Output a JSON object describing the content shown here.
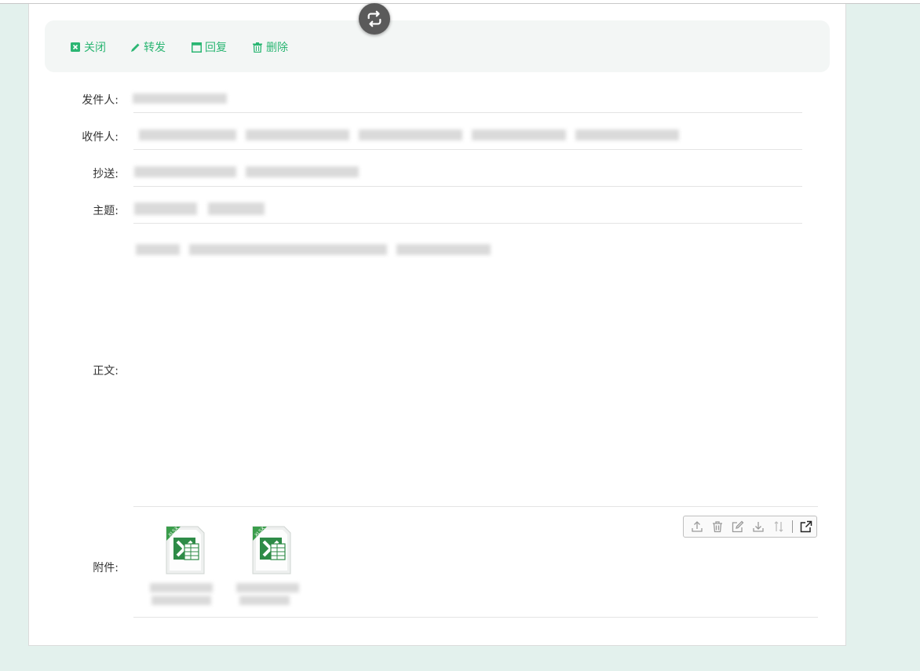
{
  "toolbar": {
    "close_label": "关闭",
    "forward_label": "转发",
    "reply_label": "回复",
    "delete_label": "删除"
  },
  "fields": {
    "sender_label": "发件人:",
    "recipient_label": "收件人:",
    "cc_label": "抄送:",
    "subject_label": "主题:",
    "body_label": "正文:",
    "attachment_label": "附件:"
  },
  "attachments": [
    {
      "type": "xlsx",
      "badge": "XLSX"
    },
    {
      "type": "xlsx",
      "badge": "XLSX"
    }
  ],
  "attachment_toolbar": {
    "icons": [
      "upload-icon",
      "trash-icon",
      "edit-icon",
      "download-icon",
      "sort-icon",
      "open-external-icon"
    ]
  },
  "colors": {
    "accent": "#2bb673",
    "background": "#e3f1ed",
    "excel_green": "#1f7a3a"
  }
}
